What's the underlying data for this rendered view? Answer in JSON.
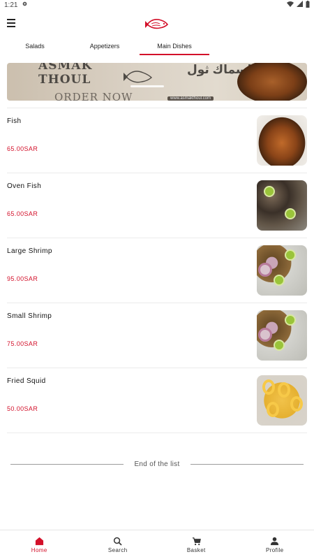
{
  "status": {
    "time": "1:21"
  },
  "tabs": [
    {
      "label": "Salads"
    },
    {
      "label": "Appetizers"
    },
    {
      "label": "Main Dishes"
    }
  ],
  "active_tab": "Main Dishes",
  "banner": {
    "title_line1": "ASMAK",
    "title_line2": "THOUL",
    "cta": "ORDER NOW",
    "arabic": "اسماك ثول",
    "url": "www.asmakthoul.com"
  },
  "items": [
    {
      "name": "Fish",
      "price": "65.00SAR",
      "image": "fish"
    },
    {
      "name": "Oven Fish",
      "price": "65.00SAR",
      "image": "ovenfish"
    },
    {
      "name": "Large Shrimp",
      "price": "95.00SAR",
      "image": "shrimp"
    },
    {
      "name": "Small Shrimp",
      "price": "75.00SAR",
      "image": "shrimp"
    },
    {
      "name": "Fried Squid",
      "price": "50.00SAR",
      "image": "squid"
    }
  ],
  "end_of_list": "End of the list",
  "bottom_nav": [
    {
      "label": "Home",
      "icon": "home-icon"
    },
    {
      "label": "Search",
      "icon": "search-icon"
    },
    {
      "label": "Basket",
      "icon": "cart-icon"
    },
    {
      "label": "Profile",
      "icon": "person-icon"
    }
  ],
  "colors": {
    "accent": "#d3102a",
    "price": "#d3102a"
  }
}
